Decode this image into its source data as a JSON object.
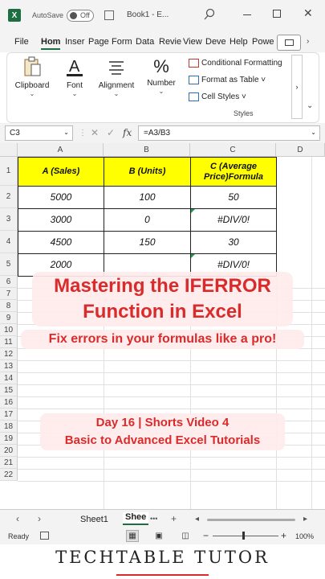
{
  "titlebar": {
    "logo_letter": "X",
    "autosave_label": "AutoSave",
    "autosave_state": "Off",
    "book_title": "Book1 - E...",
    "minimize": "",
    "close_glyph": "✕"
  },
  "menu": {
    "tabs": [
      "File",
      "Hom",
      "Inser",
      "Page",
      "Form",
      "Data",
      "Revie",
      "View",
      "Deve",
      "Help",
      "Powe"
    ],
    "active_tab": "Hom",
    "more": "›"
  },
  "ribbon": {
    "clipboard": "Clipboard",
    "font": "Font",
    "alignment": "Alignment",
    "number": "Number",
    "percent_glyph": "%",
    "chev": "⌄",
    "conditional_formatting": "Conditional Formatting",
    "format_as_table": "Format as Table ˅",
    "cell_styles": "Cell Styles ˅",
    "styles_caption": "Styles",
    "scroll_glyph": "›",
    "expand_glyph": "⌄"
  },
  "formula_bar": {
    "name_box": "C3",
    "fx": "fx",
    "formula": "=A3/B3",
    "dd": "⌄"
  },
  "grid": {
    "columns": [
      "A",
      "B",
      "C",
      "D"
    ],
    "rows": [
      "1",
      "2",
      "3",
      "4",
      "5",
      "6",
      "7",
      "8",
      "9",
      "10",
      "11",
      "12",
      "13",
      "14",
      "15",
      "16",
      "17",
      "18",
      "19",
      "20",
      "21",
      "22"
    ],
    "headers": {
      "a": "A (Sales)",
      "b": "B (Units)",
      "c": "C (Average Price)Formula"
    },
    "data": [
      {
        "a": "5000",
        "b": "100",
        "c": "50"
      },
      {
        "a": "3000",
        "b": "0",
        "c": "#DIV/0!"
      },
      {
        "a": "4500",
        "b": "150",
        "c": "30"
      },
      {
        "a": "2000",
        "b": "",
        "c": "#DIV/0!"
      }
    ]
  },
  "overlay": {
    "title_line1": "Mastering the IFERROR",
    "title_line2": "Function in Excel",
    "subtitle": "Fix errors in your formulas like a pro!",
    "day_line1": "Day 16 | Shorts Video 4",
    "day_line2": "Basic to Advanced Excel Tutorials"
  },
  "sheets": {
    "nav_prev": "‹",
    "nav_next": "›",
    "tab1": "Sheet1",
    "tab2": "Shee",
    "more": "•••",
    "add": "+",
    "scroll_left": "◂",
    "scroll_right": "▸"
  },
  "status": {
    "ready": "Ready",
    "zoom_minus": "−",
    "zoom_plus": "+",
    "zoom": "100%",
    "zoom_level": 1.0
  },
  "brand": {
    "name": "TECHTABLE TUTOR"
  },
  "colors": {
    "excel_green": "#1d6f42",
    "header_yellow": "#ffff00",
    "overlay_red": "#d92b2b",
    "error_triangle": "#1d9c4a"
  }
}
